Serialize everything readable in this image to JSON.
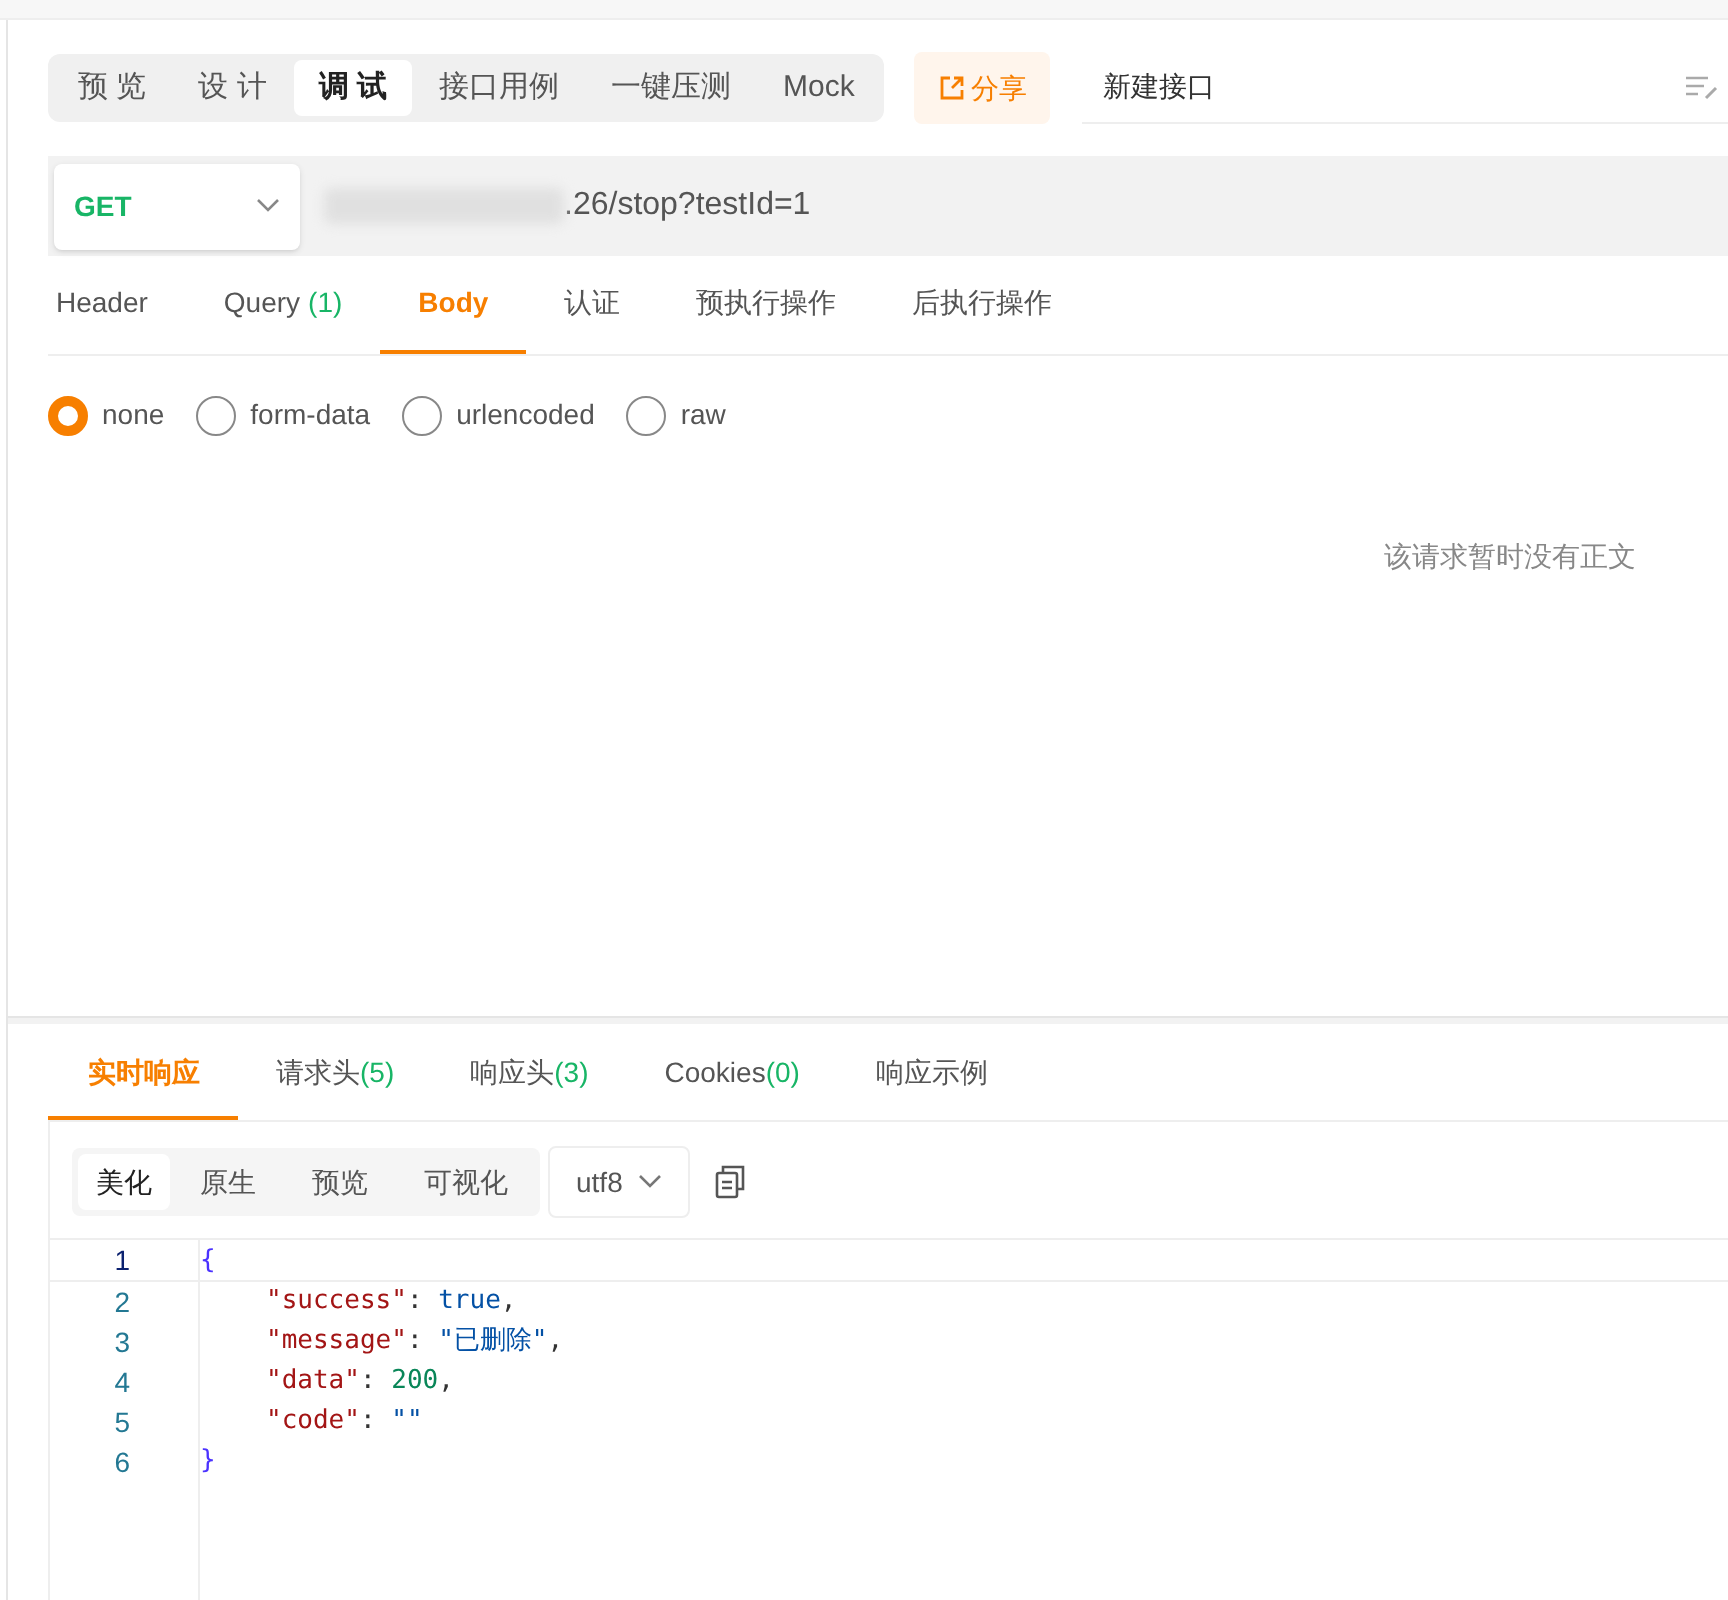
{
  "mode_tabs": [
    {
      "label": "预 览",
      "selected": false
    },
    {
      "label": "设 计",
      "selected": false
    },
    {
      "label": "调 试",
      "selected": true
    },
    {
      "label": "接口用例",
      "selected": false
    },
    {
      "label": "一键压测",
      "selected": false
    },
    {
      "label": "Mock",
      "selected": false
    }
  ],
  "share_button": {
    "label": "分享"
  },
  "name_field": {
    "value": "新建接口"
  },
  "request": {
    "method": "GET",
    "url": ".26/stop?testId=1"
  },
  "request_tabs": [
    {
      "label": "Header",
      "selected": false
    },
    {
      "label": "Query",
      "count": "(1)",
      "selected": false
    },
    {
      "label": "Body",
      "selected": true
    },
    {
      "label": "认证",
      "selected": false
    },
    {
      "label": "预执行操作",
      "selected": false
    },
    {
      "label": "后执行操作",
      "selected": false
    }
  ],
  "body_types": [
    {
      "label": "none",
      "selected": true
    },
    {
      "label": "form-data",
      "selected": false
    },
    {
      "label": "urlencoded",
      "selected": false
    },
    {
      "label": "raw",
      "selected": false
    }
  ],
  "empty_body_message": "该请求暂时没有正文",
  "response_tabs": [
    {
      "label": "实时响应",
      "selected": true
    },
    {
      "label": "请求头",
      "count": "(5)",
      "selected": false
    },
    {
      "label": "响应头",
      "count": "(3)",
      "selected": false
    },
    {
      "label": "Cookies",
      "count": "(0)",
      "selected": false
    },
    {
      "label": "响应示例",
      "selected": false
    }
  ],
  "view_modes": [
    {
      "label": "美化",
      "selected": true
    },
    {
      "label": "原生",
      "selected": false
    },
    {
      "label": "预览",
      "selected": false
    },
    {
      "label": "可视化",
      "selected": false
    }
  ],
  "encoding": "utf8",
  "code_lines": [
    {
      "number": "1",
      "kind": "brace",
      "selected": true,
      "tokens": [
        {
          "kind": "brace",
          "text": "{"
        }
      ]
    },
    {
      "number": "2",
      "kind": "member",
      "selected": false,
      "tokens": [
        {
          "kind": "key",
          "text": "\"success\""
        },
        {
          "kind": "punct",
          "text": ": "
        },
        {
          "kind": "literal",
          "text": "true"
        },
        {
          "kind": "punct",
          "text": ","
        }
      ]
    },
    {
      "number": "3",
      "kind": "member",
      "selected": false,
      "tokens": [
        {
          "kind": "key",
          "text": "\"message\""
        },
        {
          "kind": "punct",
          "text": ": "
        },
        {
          "kind": "string",
          "text": "\"已删除\""
        },
        {
          "kind": "punct",
          "text": ","
        }
      ]
    },
    {
      "number": "4",
      "kind": "member",
      "selected": false,
      "tokens": [
        {
          "kind": "key",
          "text": "\"data\""
        },
        {
          "kind": "punct",
          "text": ": "
        },
        {
          "kind": "number",
          "text": "200"
        },
        {
          "kind": "punct",
          "text": ","
        }
      ]
    },
    {
      "number": "5",
      "kind": "member",
      "selected": false,
      "tokens": [
        {
          "kind": "key",
          "text": "\"code\""
        },
        {
          "kind": "punct",
          "text": ": "
        },
        {
          "kind": "string",
          "text": "\"\""
        }
      ]
    },
    {
      "number": "6",
      "kind": "brace",
      "selected": false,
      "tokens": [
        {
          "kind": "brace",
          "text": "}"
        }
      ]
    }
  ]
}
